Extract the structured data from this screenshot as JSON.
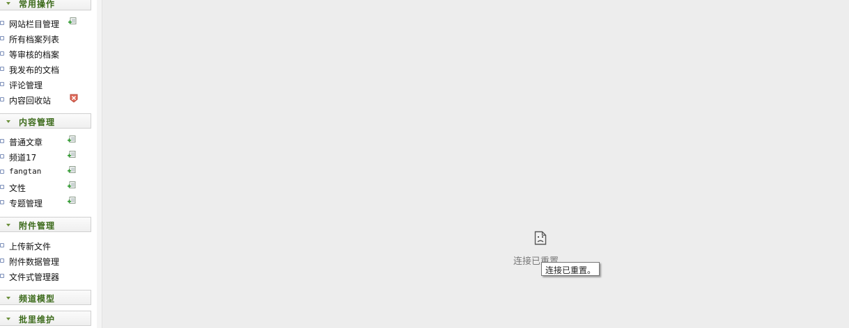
{
  "sidebar": {
    "sections": [
      {
        "title": "常用操作",
        "items": [
          {
            "label": "网站栏目管理",
            "icon": "add-doc-icon"
          },
          {
            "label": "所有档案列表",
            "icon": ""
          },
          {
            "label": "等审核的档案",
            "icon": ""
          },
          {
            "label": "我发布的文档",
            "icon": ""
          },
          {
            "label": "评论管理",
            "icon": ""
          },
          {
            "label": "内容回收站",
            "icon": "recycle-delete-icon"
          }
        ]
      },
      {
        "title": "内容管理",
        "items": [
          {
            "label": "普通文章",
            "icon": "add-doc-icon"
          },
          {
            "label": "频道17",
            "icon": "add-doc-icon"
          },
          {
            "label": "fangtan",
            "icon": "add-doc-icon"
          },
          {
            "label": "文性",
            "icon": "add-doc-icon"
          },
          {
            "label": "专题管理",
            "icon": "add-doc-icon"
          }
        ]
      },
      {
        "title": "附件管理",
        "items": [
          {
            "label": "上传新文件",
            "icon": ""
          },
          {
            "label": "附件数据管理",
            "icon": ""
          },
          {
            "label": "文件式管理器",
            "icon": ""
          }
        ]
      },
      {
        "title": "频道模型",
        "items": []
      },
      {
        "title": "批里维护",
        "items": []
      }
    ]
  },
  "main": {
    "error_icon": "sad-page-icon",
    "error_text": "连接已重置。",
    "tooltip_text": "连接已重置。"
  },
  "colors": {
    "section_title": "#3d6b1c",
    "background": "#ededed"
  }
}
